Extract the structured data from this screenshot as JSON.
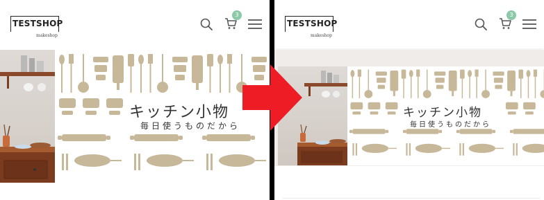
{
  "header": {
    "logo_text": "TESTSHOP",
    "logo_subtext": "makeshop",
    "cart_count": "3"
  },
  "banner": {
    "title": "キッチン小物",
    "subtitle": "毎日使うものだから"
  },
  "colors": {
    "badge": "#8cc9a6",
    "arrow": "#ee1c24",
    "utensil": "#c8b89a",
    "divider": "#000000"
  },
  "icons": [
    "search-icon",
    "cart-icon",
    "hamburger-menu-icon",
    "arrow-right-icon"
  ]
}
